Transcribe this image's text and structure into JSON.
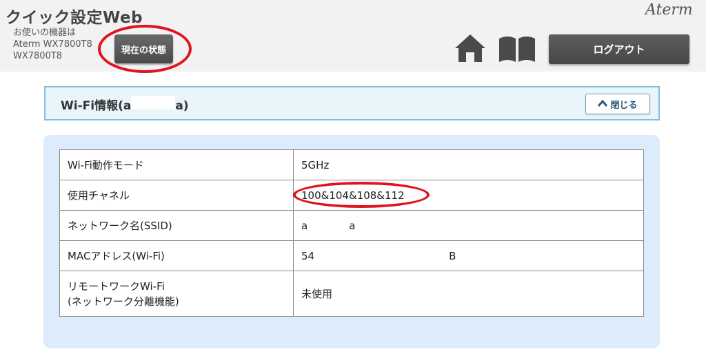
{
  "header": {
    "app_title": "クイック設定Web",
    "device_label": "お使いの機器は",
    "device_model_1": "Aterm WX7800T8",
    "device_model_2": "WX7800T8",
    "status_button": "現在の状態",
    "brand": "Aterm",
    "logout_button": "ログアウト",
    "icons": [
      "home-icon",
      "manual-book-icon"
    ]
  },
  "section": {
    "title_prefix": "Wi-Fi情報(a",
    "title_suffix": "a)",
    "close_button": "閉じる"
  },
  "table": {
    "rows": [
      {
        "label": "Wi-Fi動作モード",
        "value": "5GHz"
      },
      {
        "label": "使用チャネル",
        "value": "100&104&108&112"
      },
      {
        "label": "ネットワーク名(SSID)",
        "value": "a　　　　a"
      },
      {
        "label": "MACアドレス(Wi-Fi)",
        "value": "54　　　　　　　　　　　　　B"
      },
      {
        "label_line1": "リモートワークWi-Fi",
        "label_line2": "(ネットワーク分離機能)",
        "value": "未使用"
      }
    ]
  },
  "colors": {
    "header_bg": "#f2f2f2",
    "section_border": "#7fc0e0",
    "panel_bg": "#dcecfa",
    "highlight_ellipse": "#e0141e",
    "dark_button": "#4a4a4a"
  }
}
